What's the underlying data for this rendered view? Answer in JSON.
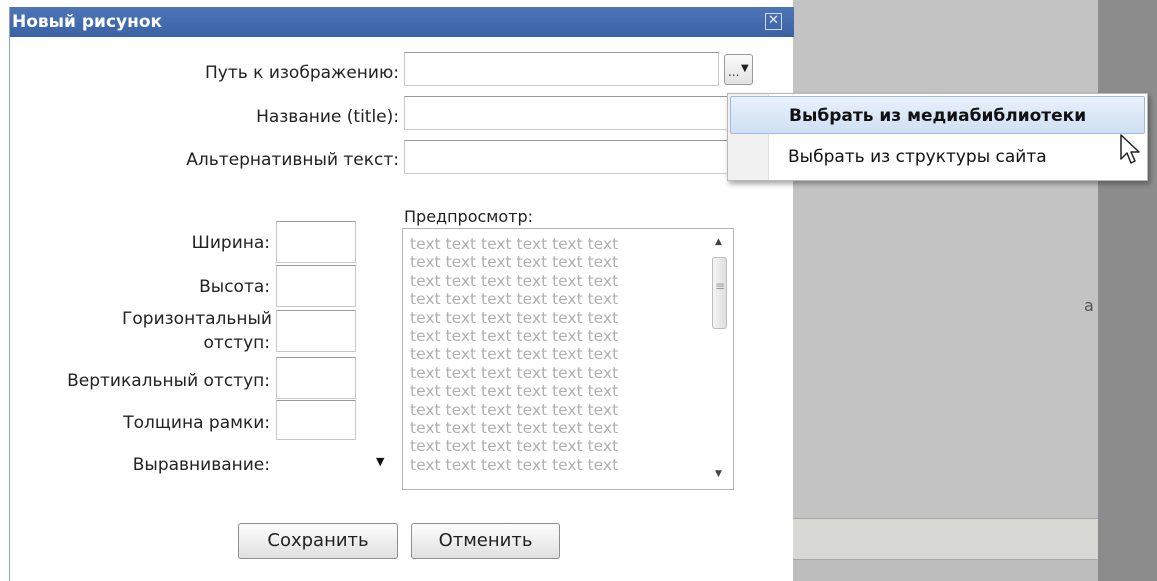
{
  "dialog": {
    "title": "Новый рисунок",
    "close_glyph": "✕"
  },
  "form": {
    "path_label": "Путь к изображению:",
    "path_value": "",
    "browse_label": "...",
    "title_label": "Название (title):",
    "title_value": "",
    "alt_label": "Альтернативный текст:",
    "alt_value": "",
    "width_label": "Ширина:",
    "height_label": "Высота:",
    "hspace_label_1": "Горизонтальный",
    "hspace_label_2": "отступ:",
    "vspace_label": "Вертикальный отступ:",
    "border_label": "Толщина рамки:",
    "align_label": "Выравнивание:",
    "align_value": ""
  },
  "preview": {
    "label": "Предпросмотр:",
    "lines": [
      "text text text text text text",
      "text text text text text text",
      "text text text text text text",
      "text text text text text text",
      "text text text text text text",
      "text text text text text text",
      "text text text text text text",
      "text text text text text text",
      "text text text text text text",
      "text text text text text text",
      "text text text text text text",
      "text text text text text text",
      "text text text text text text"
    ]
  },
  "buttons": {
    "save": "Сохранить",
    "cancel": "Отменить"
  },
  "menu": {
    "items": [
      {
        "label": "Выбрать из медиабиблиотеки",
        "highlighted": true
      },
      {
        "label": "Выбрать из структуры сайта",
        "highlighted": false
      }
    ]
  },
  "background": {
    "glyph": "a"
  },
  "icons": {
    "close": "close-icon",
    "dropdown": "chevron-down-icon",
    "scroll_up": "arrow-up-icon",
    "scroll_down": "arrow-down-icon",
    "cursor": "mouse-pointer-icon"
  },
  "colors": {
    "titlebar": "#3f68ab",
    "menu_highlight": "#d7e5f6",
    "preview_text": "#b0b0b0"
  }
}
